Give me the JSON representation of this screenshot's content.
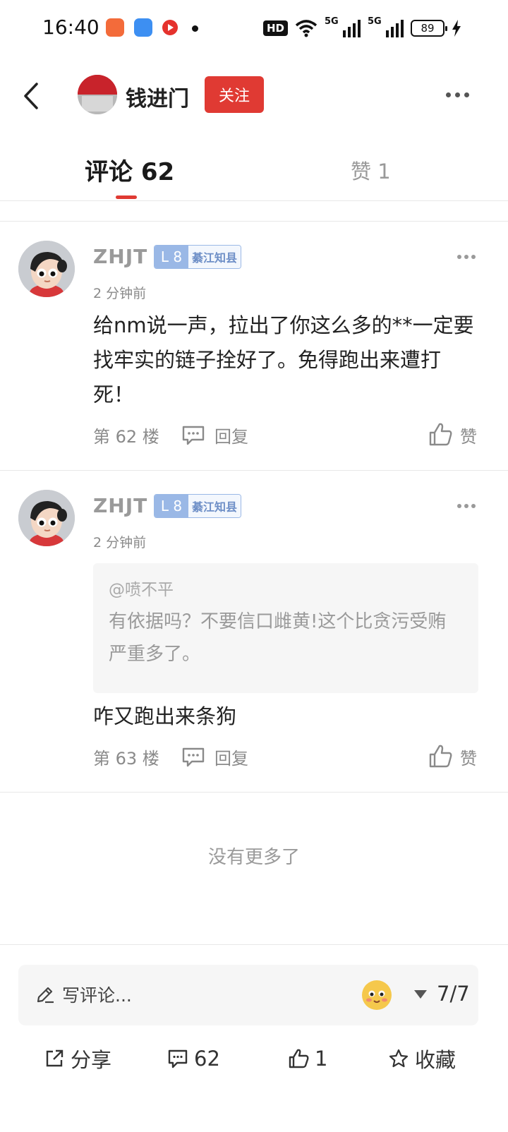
{
  "status_bar": {
    "time": "16:40",
    "network_badge": "HD",
    "signal_1": "5G",
    "signal_2": "5G",
    "battery": "89",
    "app_icons": [
      "video-app-icon",
      "blue-app-icon",
      "red-play-app-icon"
    ]
  },
  "header": {
    "author_name": "钱进门",
    "follow_label": "关注"
  },
  "tabs": {
    "comments": "评论 62",
    "likes": "赞 1"
  },
  "comments": [
    {
      "user": "ZHJT",
      "level": "L 8",
      "title": "綦江知县",
      "time": "2 分钟前",
      "text": "给nm说一声，拉出了你这么多的**一定要找牢实的链子拴好了。免得跑出来遭打死！",
      "floor": "第 62 楼",
      "reply_label": "回复",
      "like_label": "赞"
    },
    {
      "user": "ZHJT",
      "level": "L 8",
      "title": "綦江知县",
      "time": "2 分钟前",
      "quote_user": "@喷不平",
      "quote_text": "有依据吗？不要信口雌黄!这个比贪污受贿严重多了。",
      "text": "咋又跑出来条狗",
      "floor": "第 63 楼",
      "reply_label": "回复",
      "like_label": "赞"
    }
  ],
  "no_more": "没有更多了",
  "composer": {
    "placeholder": "写评论...",
    "pager": "7/7"
  },
  "actions": {
    "share": "分享",
    "comments": "62",
    "likes": "1",
    "favorite": "收藏"
  },
  "colors": {
    "accent": "#e03a33",
    "level_badge": "#9ab8e6"
  }
}
